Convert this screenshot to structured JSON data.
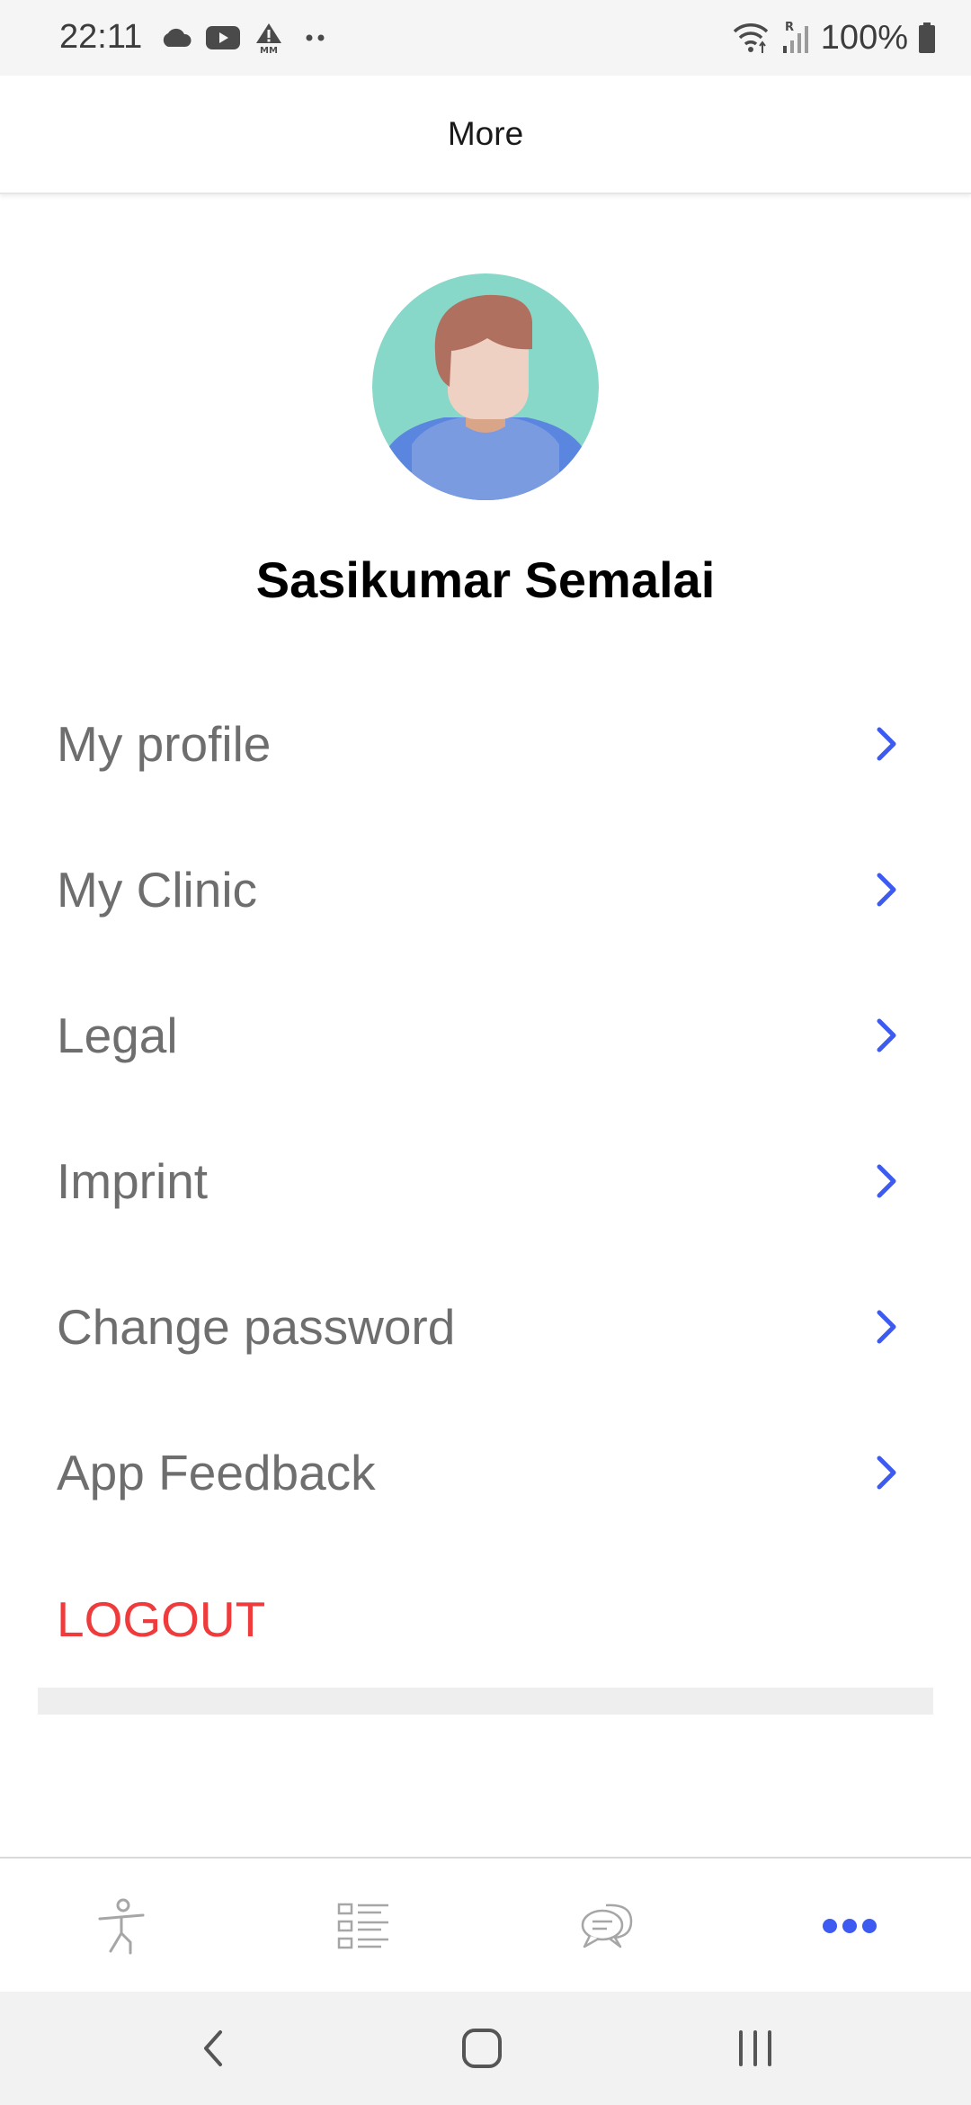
{
  "status_bar": {
    "time": "22:11",
    "battery": "100%",
    "left_icons": [
      "cloud-icon",
      "youtube-icon",
      "alert-icon",
      "more-dots-icon"
    ],
    "right_icons": [
      "wifi-icon",
      "signal-icon",
      "battery-icon"
    ]
  },
  "header": {
    "title": "More"
  },
  "profile": {
    "name": "Sasikumar Semalai",
    "avatar_icon": "user-avatar-icon"
  },
  "menu": {
    "items": [
      {
        "label": "My profile"
      },
      {
        "label": "My Clinic"
      },
      {
        "label": "Legal"
      },
      {
        "label": "Imprint"
      },
      {
        "label": "Change password"
      },
      {
        "label": "App Feedback"
      }
    ],
    "logout_label": "LOGOUT"
  },
  "tabs": [
    {
      "name": "exercise",
      "icon": "exercise-person-icon"
    },
    {
      "name": "list",
      "icon": "list-icon"
    },
    {
      "name": "chat",
      "icon": "chat-bubbles-icon"
    },
    {
      "name": "more",
      "icon": "more-dots-icon",
      "active": true
    }
  ],
  "colors": {
    "accent": "#3d5af1",
    "logout": "#ef3b3b",
    "label_gray": "#6e6e6e",
    "inactive_icon": "#a6a6a6"
  },
  "nav_bar": [
    "back-icon",
    "home-icon",
    "recent-apps-icon"
  ]
}
